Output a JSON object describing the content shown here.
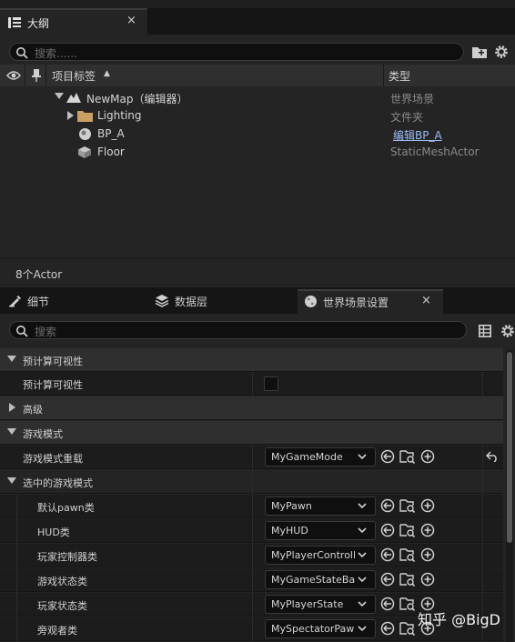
{
  "outliner": {
    "tab_label": "大纲",
    "close_glyph": "×",
    "search_placeholder": "搜索......",
    "col_label": "项目标签",
    "col_sort": "▲",
    "col_type": "类型",
    "rows": [
      {
        "name": "NewMap（编辑器）",
        "type": "世界场景",
        "icon": "map-icon"
      },
      {
        "name": "Lighting",
        "type": "文件夹",
        "icon": "folder-icon"
      },
      {
        "name": "BP_A",
        "type": "编辑BP_A",
        "icon": "blueprint-actor-icon"
      },
      {
        "name": "Floor",
        "type": "StaticMeshActor",
        "icon": "static-mesh-icon"
      }
    ],
    "status": "8个Actor"
  },
  "details_tabs": [
    {
      "label": "细节",
      "icon": "details-icon"
    },
    {
      "label": "数据层",
      "icon": "layers-icon"
    },
    {
      "label": "世界场景设置",
      "icon": "globe-icon",
      "active": true
    }
  ],
  "details": {
    "close_glyph": "×",
    "search_placeholder": "搜索",
    "sections": {
      "precompute": "预计算可视性",
      "precompute_prop": "预计算可视性",
      "advanced": "高级",
      "game_mode": "游戏模式",
      "game_mode_override": "游戏模式重载",
      "game_mode_override_value": "MyGameMode",
      "selected_game_mode": "选中的游戏模式"
    },
    "properties": [
      {
        "label": "默认pawn类",
        "value": "MyPawn"
      },
      {
        "label": "HUD类",
        "value": "MyHUD"
      },
      {
        "label": "玩家控制器类",
        "value": "MyPlayerController"
      },
      {
        "label": "游戏状态类",
        "value": "MyGameStateBase"
      },
      {
        "label": "玩家状态类",
        "value": "MyPlayerState"
      },
      {
        "label": "旁观者类",
        "value": "MySpectatorPawn"
      }
    ]
  },
  "watermark": "知乎 @BigD"
}
